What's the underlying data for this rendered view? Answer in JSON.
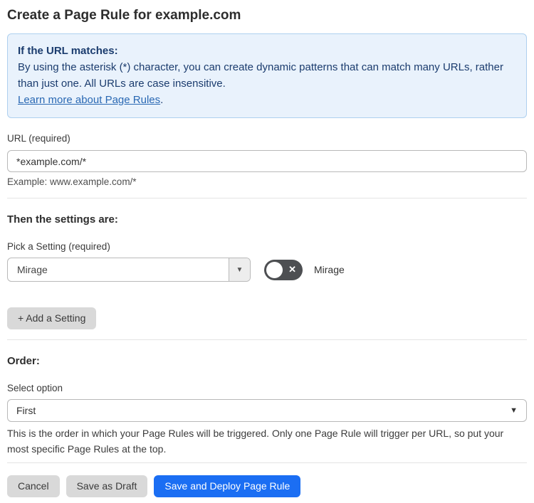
{
  "page": {
    "title": "Create a Page Rule for example.com"
  },
  "info_box": {
    "heading": "If the URL matches:",
    "body": "By using the asterisk (*) character, you can create dynamic patterns that can match many URLs, rather than just one. All URLs are case insensitive.",
    "link_label": "Learn more about Page Rules",
    "link_suffix": "."
  },
  "url_field": {
    "label": "URL (required)",
    "value": "*example.com/*",
    "helper": "Example: www.example.com/*"
  },
  "settings_section": {
    "heading": "Then the settings are:",
    "picker_label": "Pick a Setting (required)",
    "picker_value": "Mirage",
    "toggle_label": "Mirage",
    "toggle_state": "off",
    "add_button_label": "+ Add a Setting"
  },
  "order_section": {
    "heading": "Order:",
    "select_label": "Select option",
    "select_value": "First",
    "helper": "This is the order in which your Page Rules will be triggered. Only one Page Rule will trigger per URL, so put your most specific Page Rules at the top."
  },
  "footer": {
    "cancel_label": "Cancel",
    "save_draft_label": "Save as Draft",
    "save_deploy_label": "Save and Deploy Page Rule"
  },
  "icons": {
    "dropdown_arrow": "▼",
    "toggle_off_x": "✕"
  },
  "colors": {
    "accent_blue": "#1b6ef3",
    "info_bg": "#e9f2fc",
    "info_border": "#aed0ef",
    "info_text": "#1b3c6e",
    "link_blue": "#2968b3",
    "toggle_off_bg": "#4d4f52",
    "gray_button_bg": "#d9d9d9"
  }
}
